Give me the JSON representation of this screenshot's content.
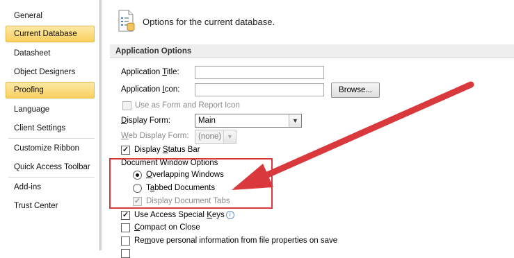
{
  "sidebar": {
    "items": [
      {
        "label": "General"
      },
      {
        "label": "Current Database"
      },
      {
        "label": "Datasheet"
      },
      {
        "label": "Object Designers"
      },
      {
        "label": "Proofing"
      },
      {
        "label": "Language"
      },
      {
        "label": "Client Settings"
      },
      {
        "label": "Customize Ribbon"
      },
      {
        "label": "Quick Access Toolbar"
      },
      {
        "label": "Add-ins"
      },
      {
        "label": "Trust Center"
      }
    ]
  },
  "header": {
    "title": "Options for the current database.",
    "icon": "database-options-icon"
  },
  "section": {
    "title": "Application Options"
  },
  "app_title": {
    "label_pre": "Application ",
    "label_key": "T",
    "label_post": "itle:",
    "value": ""
  },
  "app_icon": {
    "label_pre": "Application ",
    "label_key": "I",
    "label_post": "con:",
    "value": "",
    "browse_label": "Browse..."
  },
  "use_as_form_icon": {
    "label": "Use as Form and Report Icon",
    "checked": false
  },
  "display_form": {
    "label_key": "D",
    "label_post": "isplay Form:",
    "value": "Main"
  },
  "web_display_form": {
    "label_key": "W",
    "label_post": "eb Display Form:",
    "value": "(none)"
  },
  "display_status_bar": {
    "label_pre": "Display ",
    "label_key": "S",
    "label_post": "tatus Bar",
    "checked": true
  },
  "doc_window": {
    "title": "Document Window Options",
    "overlapping": {
      "label_key": "O",
      "label_post": "verlapping Windows",
      "selected": true
    },
    "tabbed": {
      "label_pre": "T",
      "label_key": "a",
      "label_post": "bbed Documents",
      "selected": false
    },
    "display_tabs": {
      "label": "Display Document Tabs",
      "checked": true
    }
  },
  "special_keys": {
    "label_pre": "Use Access Special ",
    "label_key": "K",
    "label_post": "eys",
    "checked": true
  },
  "compact_on_close": {
    "label_key": "C",
    "label_post": "ompact on Close",
    "checked": false
  },
  "remove_personal": {
    "label_pre": "Re",
    "label_key": "m",
    "label_post": "ove personal information from file properties on save",
    "checked": false
  },
  "colors": {
    "highlight": "#f9cf5e",
    "annotation": "#d9393c"
  }
}
